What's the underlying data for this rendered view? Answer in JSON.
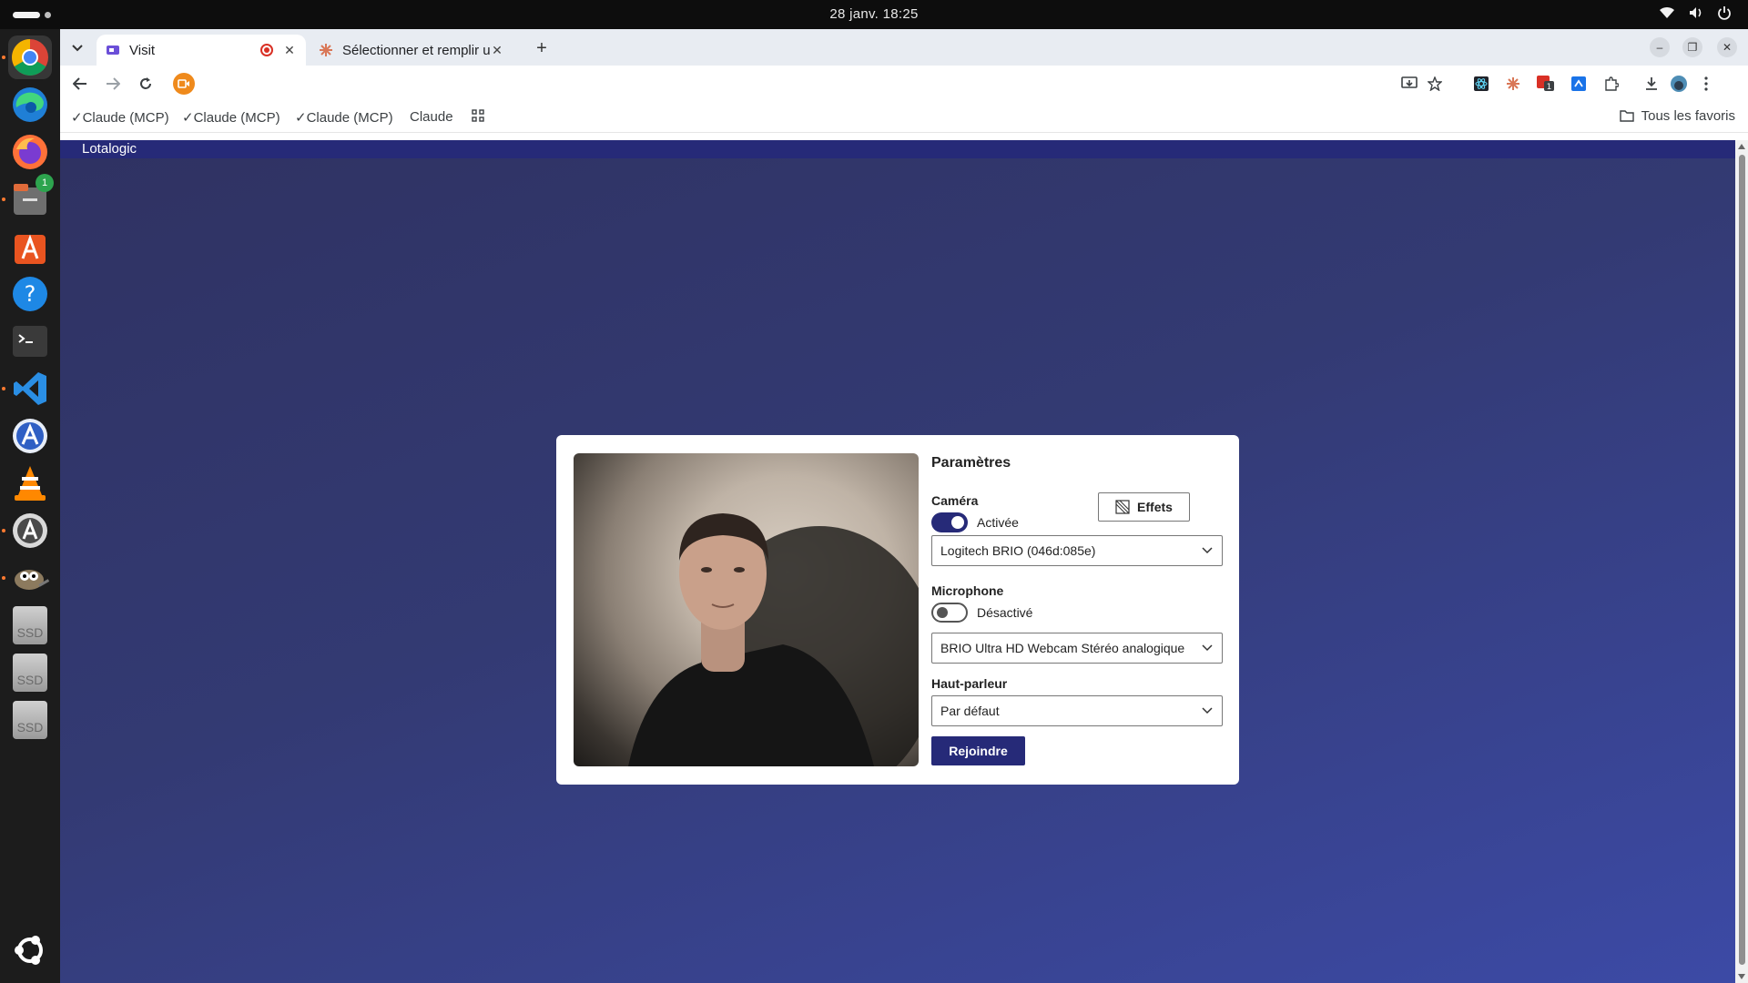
{
  "system": {
    "clock": "28 janv.  18:25"
  },
  "dock": {
    "items": [
      {
        "name": "chrome"
      },
      {
        "name": "edge"
      },
      {
        "name": "firefox"
      },
      {
        "name": "files",
        "badge": "1"
      },
      {
        "name": "app-center"
      },
      {
        "name": "help"
      },
      {
        "name": "terminal"
      },
      {
        "name": "vscode"
      },
      {
        "name": "app-grid-a"
      },
      {
        "name": "vlc"
      },
      {
        "name": "software-updater"
      },
      {
        "name": "gimp"
      },
      {
        "name": "ssd-1",
        "label": "SSD"
      },
      {
        "name": "ssd-2",
        "label": "SSD"
      },
      {
        "name": "ssd-3",
        "label": "SSD"
      },
      {
        "name": "ubuntu-apps"
      }
    ]
  },
  "browser": {
    "tabs": [
      {
        "title": "Visit",
        "active": true
      },
      {
        "title": "Sélectionner et remplir u",
        "active": false
      }
    ],
    "bookmarks": [
      "Claude (MCP)",
      "Claude (MCP)",
      "Claude (MCP)",
      "Claude"
    ],
    "all_bookmarks": "Tous les favoris"
  },
  "page": {
    "brand": "Lotalogic",
    "settings": {
      "title": "Paramètres",
      "camera": {
        "label": "Caméra",
        "state": "Activée",
        "enabled": true,
        "device": "Logitech BRIO (046d:085e)",
        "effects_label": "Effets"
      },
      "microphone": {
        "label": "Microphone",
        "state": "Désactivé",
        "enabled": false,
        "device": "BRIO Ultra HD Webcam Stéréo analogique"
      },
      "speaker": {
        "label": "Haut-parleur",
        "device": "Par défaut"
      },
      "join_label": "Rejoindre"
    }
  },
  "colors": {
    "accent": "#262a78",
    "page_gradient_start": "#2f3262",
    "page_gradient_end": "#3c4aa6",
    "record": "#d93025",
    "record_chip": "#ef8a1c"
  }
}
